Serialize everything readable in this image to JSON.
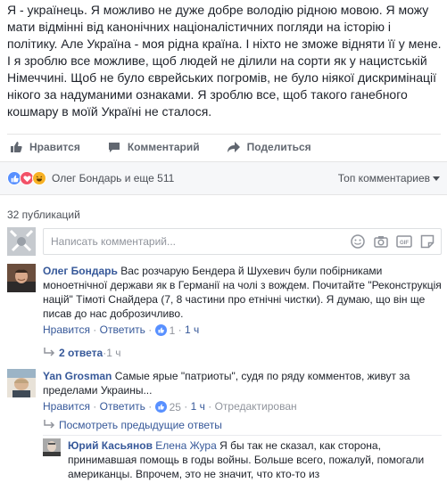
{
  "post": {
    "text": "Я - українець. Я можливо не дуже добре володію рідною мовою. Я можу мати відмінні від канонічних націоналістичних погляди на історію і політику. Але Україна - моя рідна країна. І ніхто не зможе відняти її у мене. І я зроблю все можливе, щоб людей не ділили на сорти як у нацистській Німеччині. Щоб не було єврейських погромів, не було ніякої дискримінації нікого за надуманими ознаками. Я зроблю все, щоб такого ганебного кошмару в моїй Україні не сталося."
  },
  "actions": {
    "like": "Нравится",
    "comment": "Комментарий",
    "share": "Поделиться"
  },
  "reactions": {
    "summary": "Олег Бондарь и еще 511",
    "sort_label": "Топ комментариев",
    "colors": {
      "like": "#5890ff",
      "love": "#f25268",
      "haha": "#f7b125"
    }
  },
  "publications": "32 публикаций",
  "composer": {
    "placeholder": "Написать комментарий..."
  },
  "comments": [
    {
      "author": "Олег Бондарь",
      "text": "Вас розчарую Бендера й Шухевич були побірниками моноетнічної держави як в Германії на чолі з вождем. Почитайте \"Реконструкція націй\" Тімоті Снайдера (7, 8 частини про етнічні чистки). Я думаю, що він ще писав до нас доброзичливо.",
      "like": "Нравится",
      "reply": "Ответить",
      "likes": "1",
      "time": "1 ч",
      "replies": "2 ответа",
      "replies_time": "1 ч"
    },
    {
      "author": "Yan Grosman",
      "text": "Самые ярые \"патриоты\", судя по ряду комментов, живут за пределами Украины...",
      "like": "Нравится",
      "reply": "Ответить",
      "likes": "25",
      "time": "1 ч",
      "edited": "Отредактирован",
      "prev_replies": "Посмотреть предыдущие ответы"
    }
  ],
  "reply": {
    "author": "Юрий Касьянов",
    "mention": "Елена Жура",
    "text": "Я бы так не сказал, как сторона, принимавшая помощь в годы войны. Больше всего, пожалуй, помогали американцы. Впрочем, это не значит, что кто-то из"
  },
  "separators": {
    "dot": " · "
  }
}
